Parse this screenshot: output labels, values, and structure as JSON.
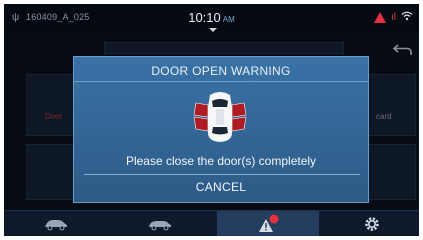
{
  "status": {
    "trip_id": "160409_A_025",
    "time": "10:10",
    "ampm": "AM"
  },
  "background": {
    "tile_left_label": "Door",
    "tile_right_label": "card"
  },
  "dialog": {
    "title": "DOOR OPEN WARNING",
    "message": "Please close the door(s) completely",
    "cancel_label": "CANCEL"
  },
  "tabs": [
    {
      "icon": "car-icon"
    },
    {
      "icon": "car-side-icon"
    },
    {
      "icon": "alert-icon",
      "badge": "1"
    },
    {
      "icon": "gear-icon"
    }
  ],
  "colors": {
    "dialog_bg": "#2d5a86",
    "warning": "#e53040",
    "accent": "#7aa7d6"
  }
}
